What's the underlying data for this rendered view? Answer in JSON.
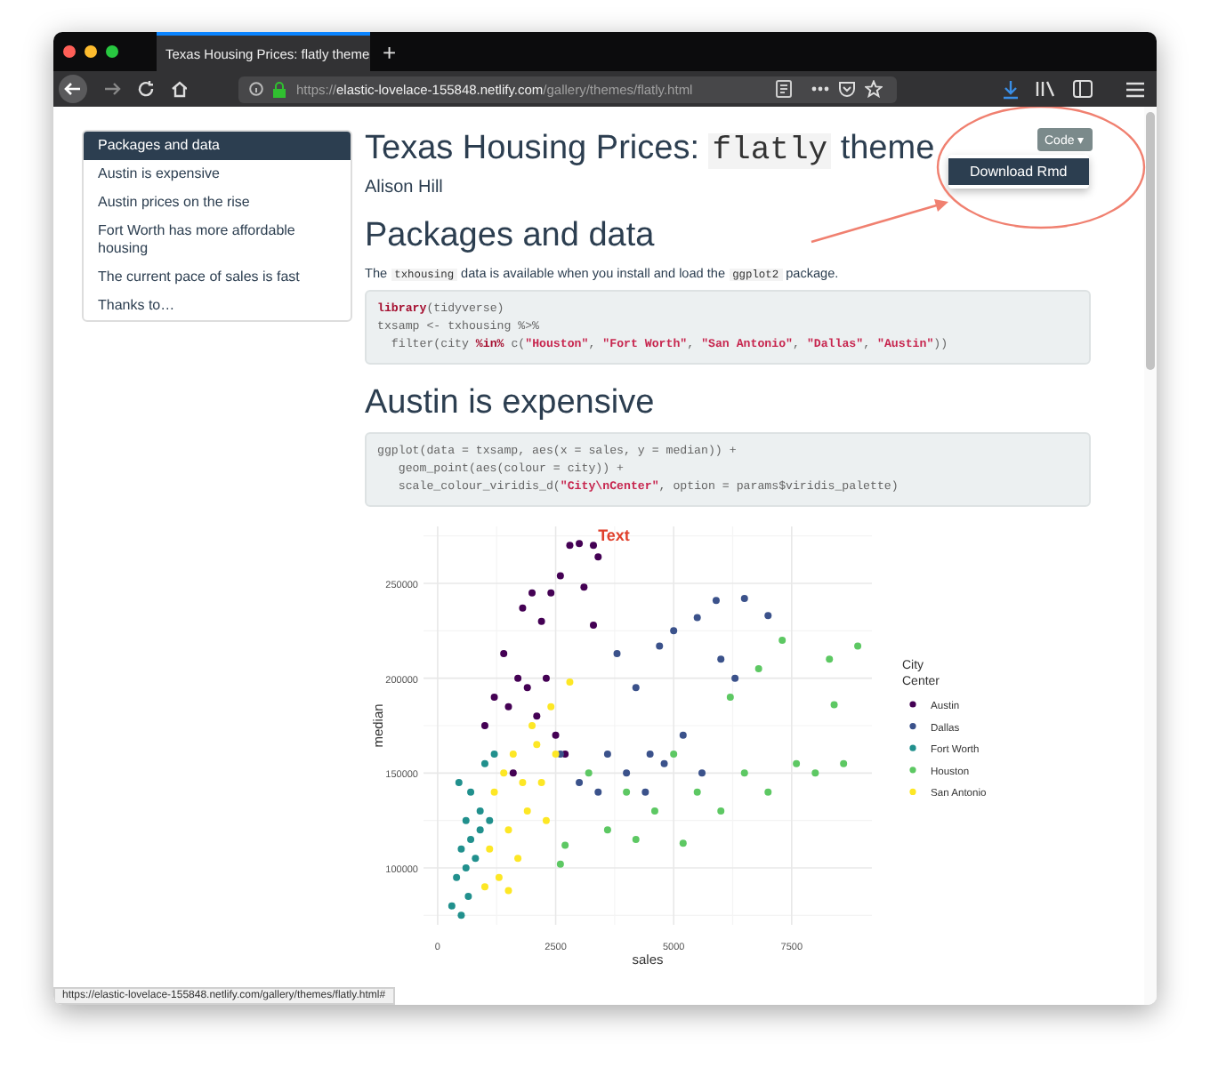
{
  "browser": {
    "tab_title": "Texas Housing Prices: flatly theme",
    "new_tab": "+",
    "url": [
      {
        "text": "https://",
        "kind": "dim"
      },
      {
        "text": "elastic-lovelace-155848.netlify.com",
        "kind": "host"
      },
      {
        "text": "/gallery/themes/flatly.html",
        "kind": "dim"
      }
    ]
  },
  "toc": [
    {
      "label": "Packages and data",
      "selected": true
    },
    {
      "label": "Austin is expensive",
      "selected": false
    },
    {
      "label": "Austin prices on the rise",
      "selected": false
    },
    {
      "label": "Fort Worth has more affordable housing",
      "selected": false
    },
    {
      "label": "The current pace of sales is fast",
      "selected": false
    },
    {
      "label": "Thanks to…",
      "selected": false
    }
  ],
  "code_button": {
    "label": "Code",
    "caret": "▾"
  },
  "code_menu": [
    "Download Rmd"
  ],
  "title": [
    {
      "text": "Texas Housing Prices: ",
      "kind": "plain"
    },
    {
      "text": "flatly",
      "kind": "code"
    },
    {
      "text": " theme",
      "kind": "plain"
    }
  ],
  "author": "Alison Hill",
  "sections": [
    {
      "heading": "Packages and data",
      "paragraph": [
        {
          "text": "The ",
          "kind": "plain"
        },
        {
          "text": "txhousing",
          "kind": "code"
        },
        {
          "text": " data is available when you install and load the ",
          "kind": "plain"
        },
        {
          "text": "ggplot2",
          "kind": "code"
        },
        {
          "text": " package.",
          "kind": "plain"
        }
      ],
      "code": [
        [
          {
            "text": "library",
            "kind": "keyword"
          },
          {
            "text": "(tidyverse)",
            "kind": "plain"
          }
        ],
        [
          {
            "text": "txsamp <- txhousing %>%",
            "kind": "plain"
          }
        ],
        [
          {
            "text": "  filter(city ",
            "kind": "plain"
          },
          {
            "text": "%in%",
            "kind": "keyword"
          },
          {
            "text": " c(",
            "kind": "plain"
          },
          {
            "text": "\"Houston\"",
            "kind": "string"
          },
          {
            "text": ", ",
            "kind": "plain"
          },
          {
            "text": "\"Fort Worth\"",
            "kind": "string"
          },
          {
            "text": ", ",
            "kind": "plain"
          },
          {
            "text": "\"San Antonio\"",
            "kind": "string"
          },
          {
            "text": ", ",
            "kind": "plain"
          },
          {
            "text": "\"Dallas\"",
            "kind": "string"
          },
          {
            "text": ", ",
            "kind": "plain"
          },
          {
            "text": "\"Austin\"",
            "kind": "string"
          },
          {
            "text": "))",
            "kind": "plain"
          }
        ]
      ]
    },
    {
      "heading": "Austin is expensive",
      "code": [
        [
          {
            "text": "ggplot(data = txsamp, aes(x = sales, y = median)) +",
            "kind": "plain"
          }
        ],
        [
          {
            "text": "   geom_point(aes(colour = city)) +",
            "kind": "plain"
          }
        ],
        [
          {
            "text": "   scale_colour_viridis_d(",
            "kind": "plain"
          },
          {
            "text": "\"City\\nCenter\"",
            "kind": "string"
          },
          {
            "text": ", option = params$viridis_palette)",
            "kind": "plain"
          }
        ]
      ],
      "chart_data": {
        "type": "scatter",
        "grid": true,
        "legend": {
          "title": [
            "City",
            "Center"
          ]
        },
        "title": "Text",
        "xlabel": "sales",
        "ylabel": "median",
        "xlim": [
          -300,
          9200
        ],
        "ylim": [
          70000,
          280000
        ],
        "xticks": [
          0,
          2500,
          5000,
          7500
        ],
        "yticks": [
          100000,
          150000,
          200000,
          250000
        ],
        "series": [
          {
            "name": "Austin",
            "color": "#440154",
            "x": [
              1000,
              1200,
              1400,
              1500,
              1700,
              1800,
              1900,
              2000,
              2100,
              2200,
              2300,
              2400,
              2500,
              2600,
              2800,
              3000,
              3100,
              3300,
              3400,
              3300,
              2700,
              1600
            ],
            "values": [
              175000,
              190000,
              213000,
              185000,
              200000,
              237000,
              195000,
              245000,
              180000,
              230000,
              200000,
              245000,
              170000,
              254000,
              270000,
              271000,
              248000,
              270000,
              264000,
              228000,
              160000,
              150000
            ]
          },
          {
            "name": "Dallas",
            "color": "#3b528b",
            "x": [
              2600,
              3000,
              3400,
              3800,
              4000,
              4200,
              4500,
              4700,
              5000,
              5200,
              5500,
              5900,
              6000,
              6300,
              6500,
              7000,
              4400,
              3600,
              4800,
              5600
            ],
            "values": [
              160000,
              145000,
              140000,
              213000,
              150000,
              195000,
              160000,
              217000,
              225000,
              170000,
              232000,
              241000,
              210000,
              200000,
              242000,
              233000,
              140000,
              160000,
              155000,
              150000
            ]
          },
          {
            "name": "Fort Worth",
            "color": "#21908d",
            "x": [
              300,
              400,
              500,
              500,
              600,
              600,
              700,
              700,
              800,
              900,
              900,
              1000,
              1100,
              1200,
              450,
              650
            ],
            "values": [
              80000,
              95000,
              75000,
              110000,
              100000,
              125000,
              115000,
              140000,
              105000,
              130000,
              120000,
              155000,
              125000,
              160000,
              145000,
              85000
            ]
          },
          {
            "name": "Houston",
            "color": "#5dc863",
            "x": [
              2700,
              3200,
              3600,
              4000,
              4200,
              4600,
              5000,
              5200,
              5500,
              6000,
              6200,
              6500,
              6800,
              7000,
              7300,
              7600,
              8000,
              8300,
              8400,
              8900,
              8600,
              2600
            ],
            "values": [
              112000,
              150000,
              120000,
              140000,
              115000,
              130000,
              160000,
              113000,
              140000,
              130000,
              190000,
              150000,
              205000,
              140000,
              220000,
              155000,
              150000,
              210000,
              186000,
              217000,
              155000,
              102000
            ]
          },
          {
            "name": "San Antonio",
            "color": "#fde725",
            "x": [
              1000,
              1100,
              1300,
              1400,
              1500,
              1600,
              1700,
              1800,
              1900,
              2000,
              2200,
              2300,
              2400,
              2500,
              2800,
              1200,
              2100,
              1500
            ],
            "values": [
              90000,
              110000,
              95000,
              150000,
              120000,
              160000,
              105000,
              145000,
              130000,
              175000,
              145000,
              125000,
              185000,
              160000,
              198000,
              140000,
              165000,
              88000
            ]
          }
        ]
      }
    }
  ],
  "status_url": "https://elastic-lovelace-155848.netlify.com/gallery/themes/flatly.html#"
}
